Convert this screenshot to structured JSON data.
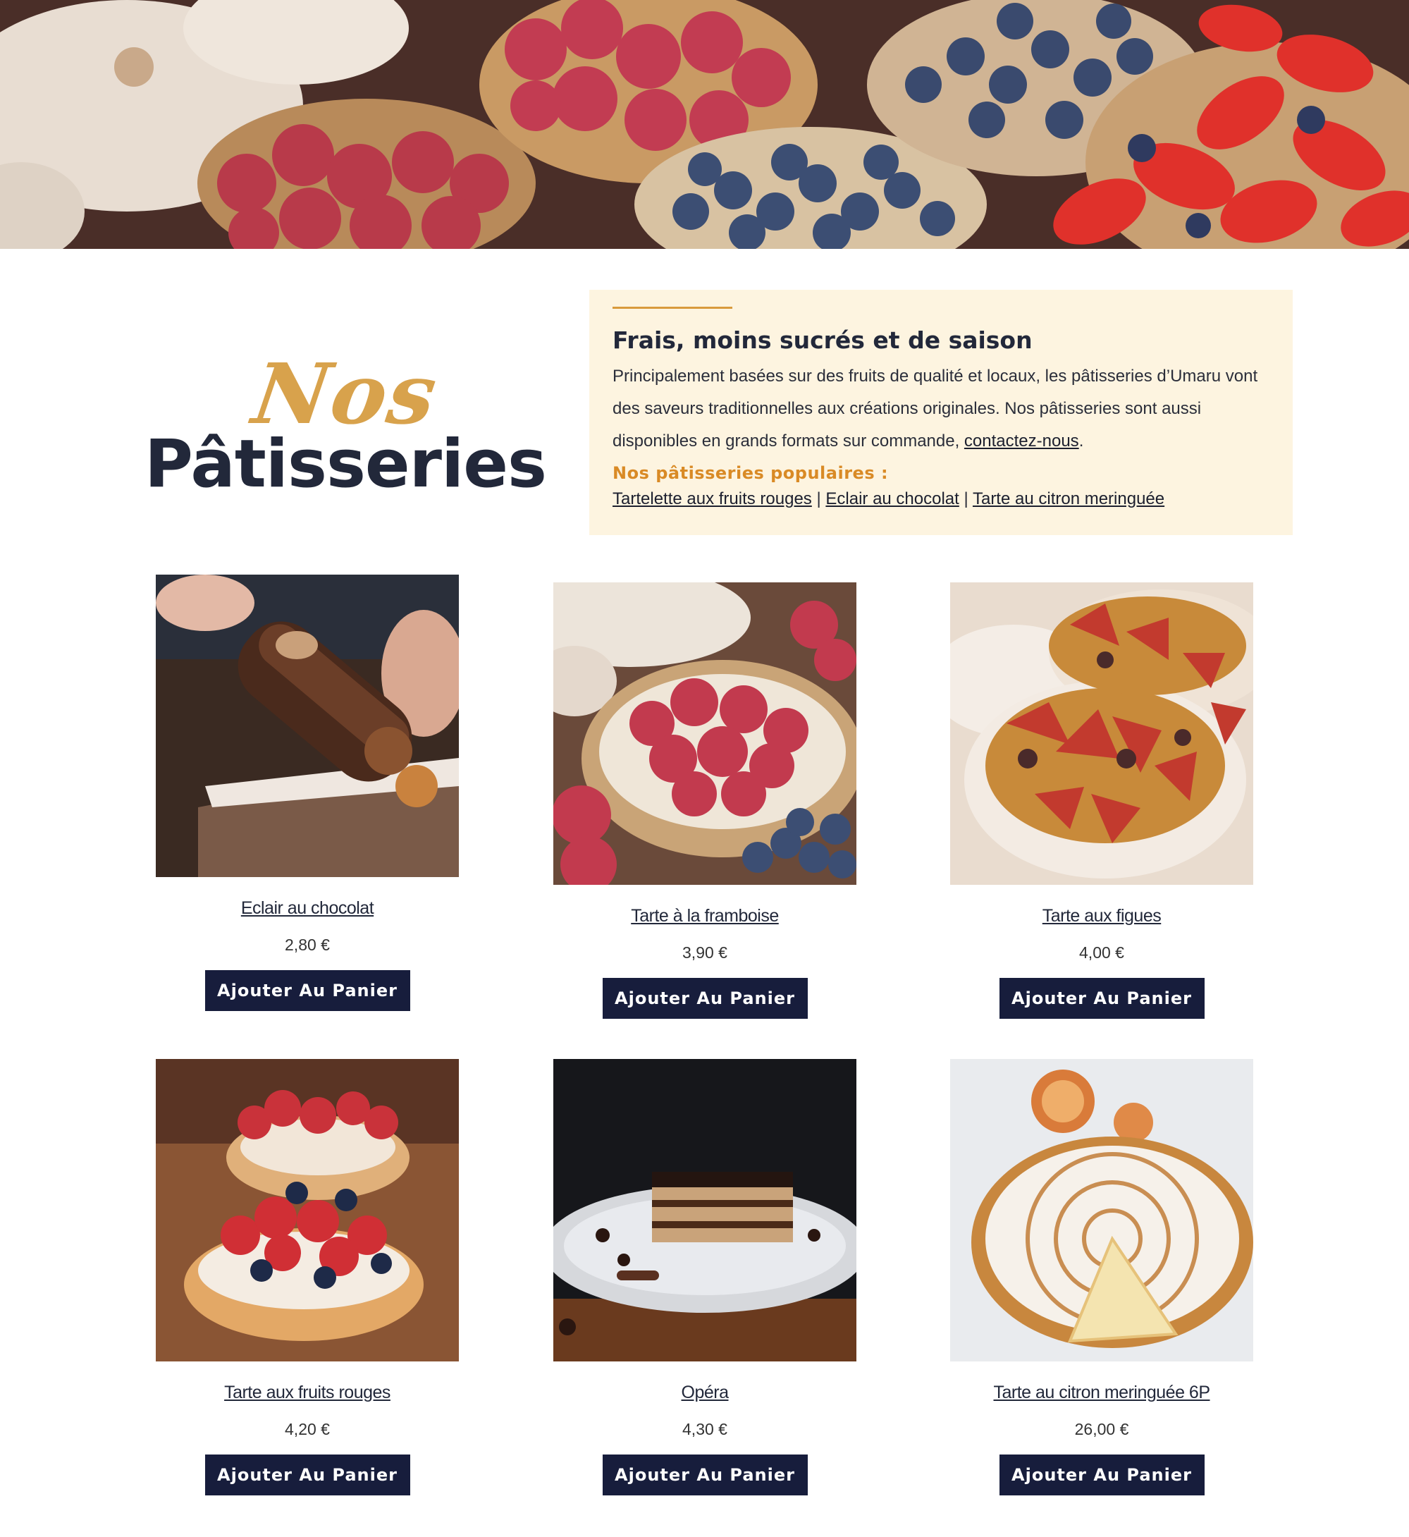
{
  "hero": {
    "image": "pastry-tarts-banner"
  },
  "title": {
    "script": "Nos",
    "main": "Pâtisseries"
  },
  "info": {
    "heading": "Frais, moins sucrés et de saison",
    "text": "Principalement basées sur des fruits de qualité et locaux, les pâtisseries d’Umaru vont des saveurs traditionnelles aux créations originales. Nos pâtisseries sont aussi disponibles en grands formats sur commande, ",
    "contact_link": "contactez-nous",
    "text_end": ".",
    "popular_title": "Nos pâtisseries populaires :",
    "popular_links": [
      "Tartelette aux fruits rouges",
      "Eclair au chocolat",
      "Tarte au citron meringuée"
    ],
    "separator": " | "
  },
  "products": [
    {
      "name": "Eclair au chocolat",
      "price": "2,80 €",
      "button": "Ajouter Au Panier",
      "image": "chocolate-eclair"
    },
    {
      "name": "Tarte à la framboise",
      "price": "3,90 €",
      "button": "Ajouter Au Panier",
      "image": "raspberry-tart"
    },
    {
      "name": "Tarte aux figues",
      "price": "4,00 €",
      "button": "Ajouter Au Panier",
      "image": "fig-tart"
    },
    {
      "name": "Tarte aux fruits rouges",
      "price": "4,20 €",
      "button": "Ajouter Au Panier",
      "image": "red-fruit-tartlet"
    },
    {
      "name": "Opéra",
      "price": "4,30 €",
      "button": "Ajouter Au Panier",
      "image": "opera-cake"
    },
    {
      "name": "Tarte au citron meringuée 6P",
      "price": "26,00 €",
      "button": "Ajouter Au Panier",
      "image": "lemon-meringue-pie"
    }
  ],
  "colors": {
    "accent": "#d8a24c",
    "navy": "#171d3c",
    "info_bg": "#fdf4e0",
    "popular_title": "#d98a25"
  }
}
